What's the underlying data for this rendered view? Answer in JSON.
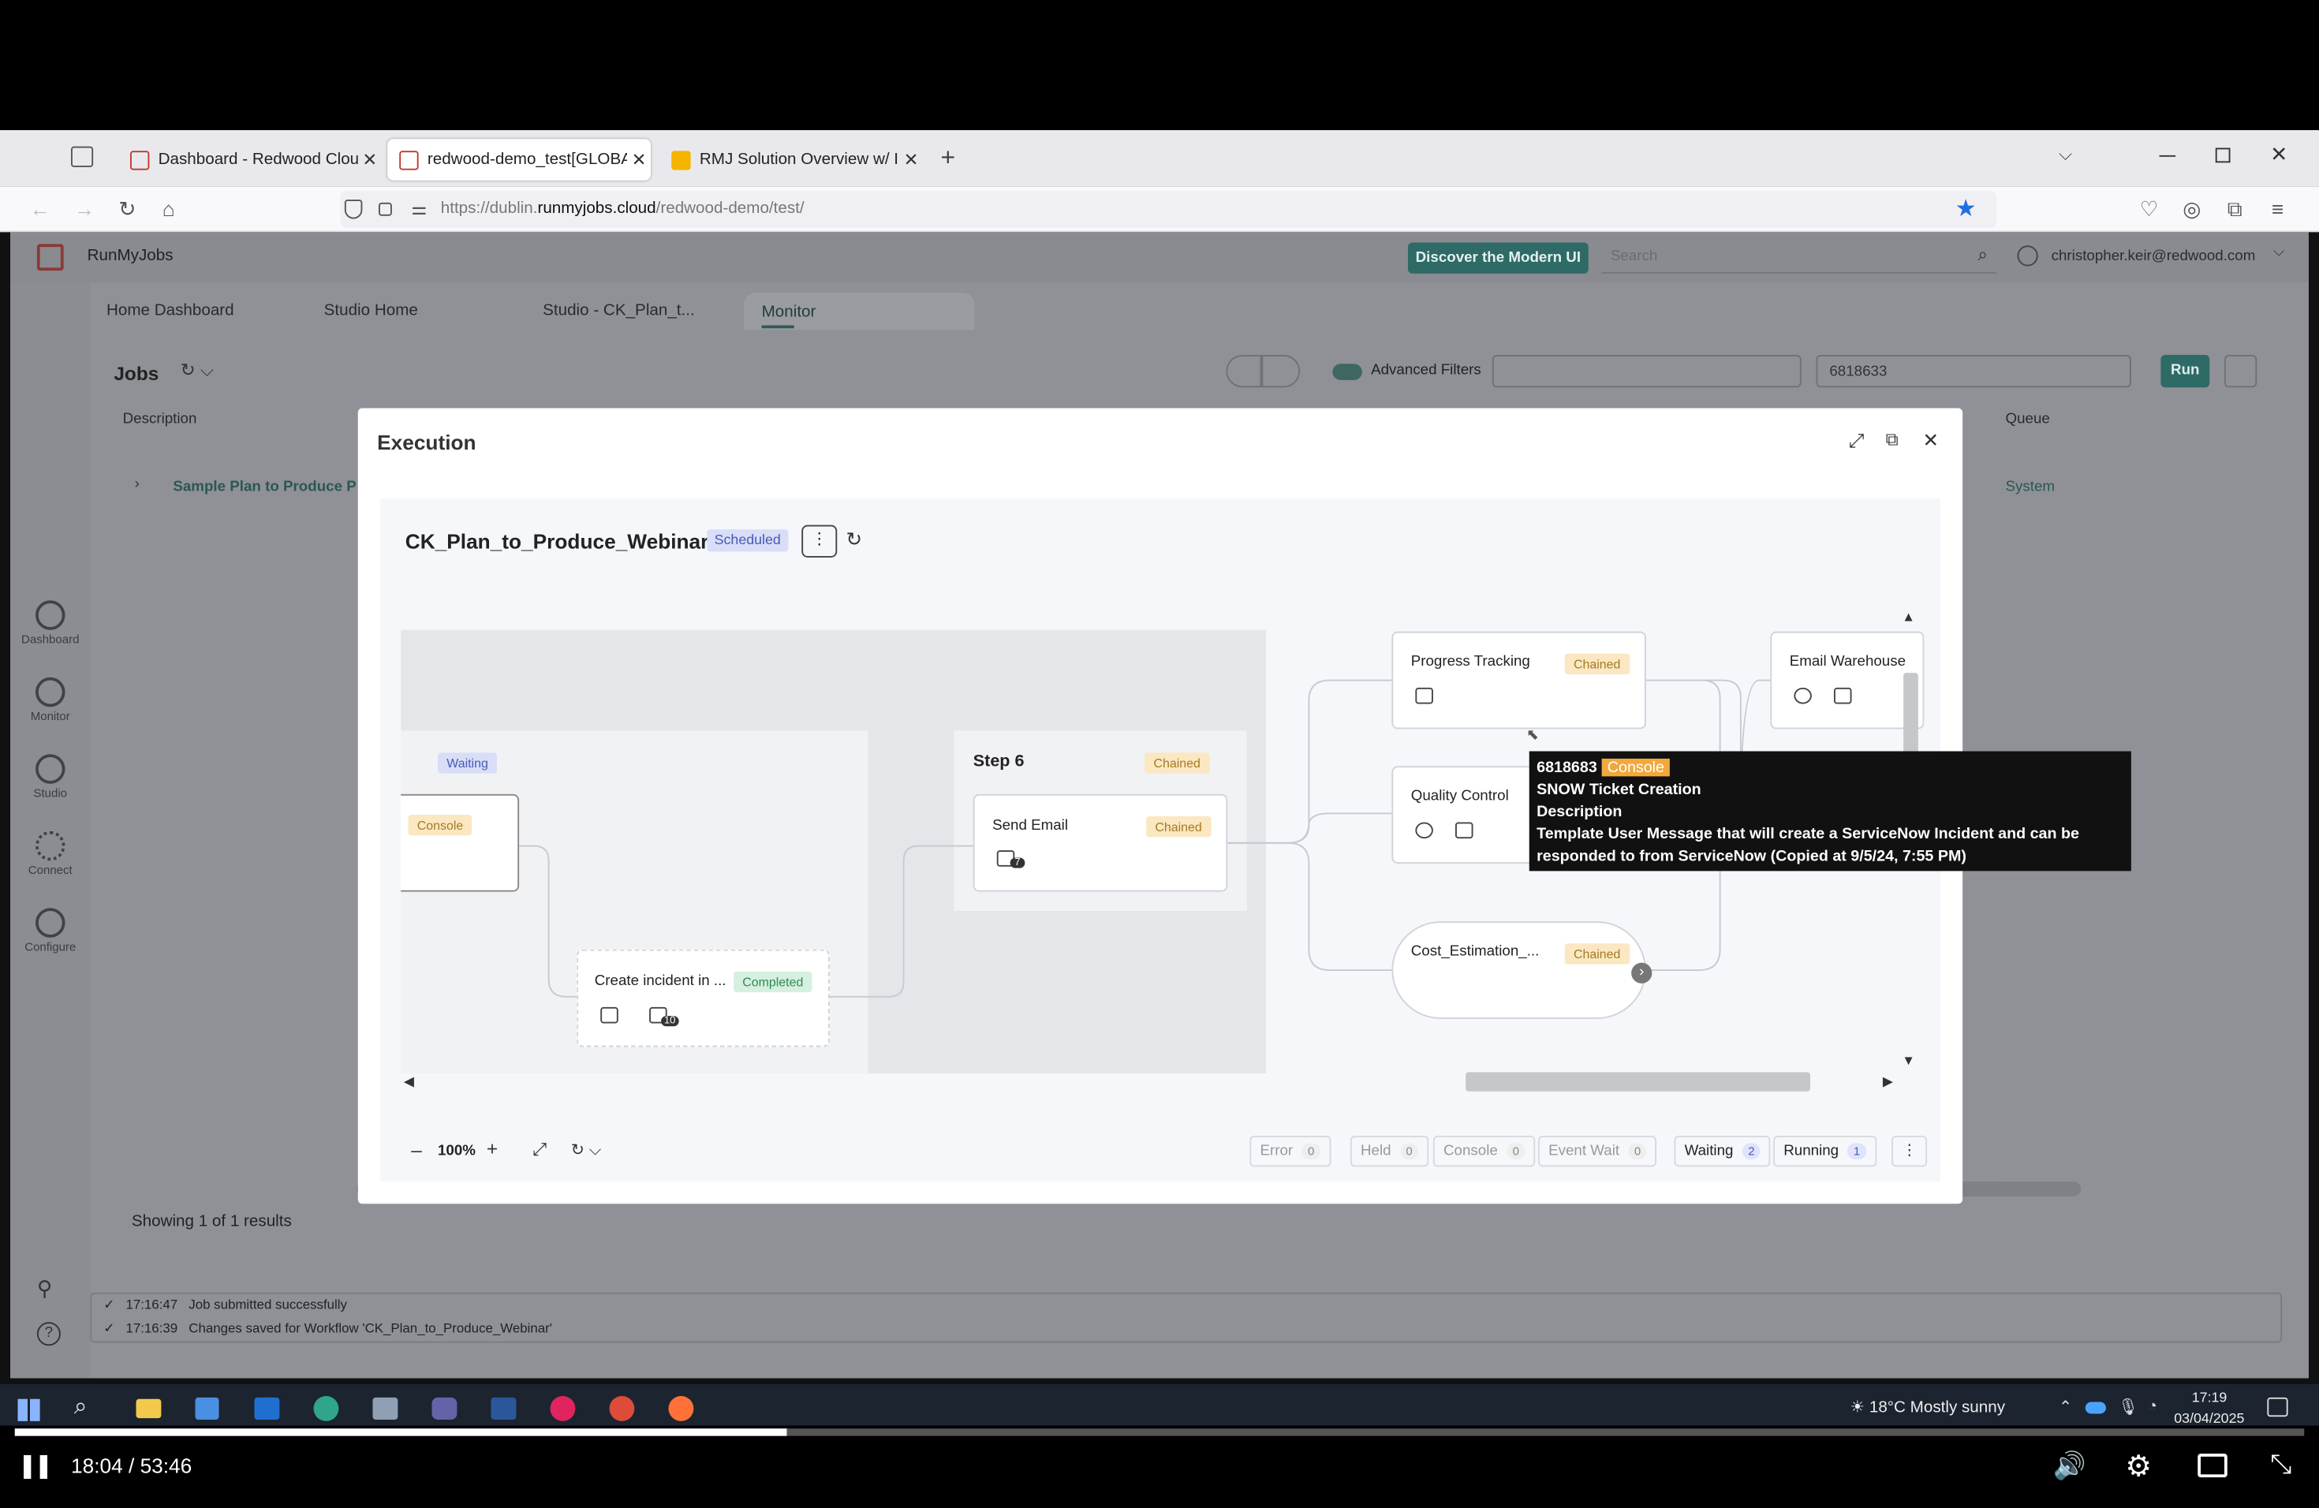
{
  "browser": {
    "tabs": [
      {
        "label": "Dashboard - Redwood Cloud",
        "active": false
      },
      {
        "label": "redwood-demo_test[GLOBAL]",
        "active": true
      },
      {
        "label": "RMJ Solution Overview w/ Insig",
        "active": false
      }
    ],
    "url_prefix": "https://dublin.",
    "url_domain": "runmyjobs.cloud",
    "url_path": "/redwood-demo/test/"
  },
  "app": {
    "name": "RunMyJobs",
    "discover_button": "Discover the Modern UI",
    "search_placeholder": "Search",
    "user": "christopher.keir@redwood.com",
    "tabs": [
      "Home Dashboard",
      "Studio Home",
      "Studio - CK_Plan_t...",
      "Monitor"
    ],
    "active_tab": "Monitor",
    "sidenav": [
      "Dashboard",
      "Monitor",
      "Studio",
      "Connect",
      "Configure"
    ],
    "jobs_title": "Jobs",
    "advanced_filters": "Advanced Filters",
    "filter_search": "6818633",
    "run_button": "Run",
    "col_description": "Description",
    "col_queue": "Queue",
    "row_description": "Sample Plan to Produce P",
    "row_queue": "System",
    "results": "Showing 1 of 1 results",
    "notifications": [
      {
        "time": "17:16:47",
        "text": "Job submitted successfully"
      },
      {
        "time": "17:16:39",
        "text": "Changes saved for Workflow 'CK_Plan_to_Produce_Webinar'"
      }
    ]
  },
  "modal": {
    "title": "Execution",
    "workflow_name": "CK_Plan_to_Produce_Webinar",
    "workflow_status": "Scheduled",
    "nodes": {
      "waiting_badge": "Waiting",
      "console_badge": "Console",
      "create_incident": {
        "label": "Create incident in ...",
        "badge": "Completed",
        "count": "10"
      },
      "step6": {
        "label": "Step 6",
        "badge": "Chained"
      },
      "send_email": {
        "label": "Send Email",
        "badge": "Chained",
        "count": "7"
      },
      "progress_tracking": {
        "label": "Progress Tracking",
        "badge": "Chained"
      },
      "quality_control": {
        "label": "Quality Control"
      },
      "cost_estimation": {
        "label": "Cost_Estimation_...",
        "badge": "Chained"
      },
      "email_warehouse": {
        "label": "Email Warehouse"
      }
    },
    "tooltip": {
      "job_id": "6818683",
      "badge": "Console",
      "name": "SNOW Ticket Creation",
      "desc_heading": "Description",
      "desc_line1": "Template User Message that will create a ServiceNow Incident and can be",
      "desc_line2": "responded to from ServiceNow (Copied at 9/5/24, 7:55 PM)"
    },
    "zoom": "100%",
    "status_pills": [
      {
        "label": "Error",
        "count": "0",
        "active": false
      },
      {
        "label": "Held",
        "count": "0",
        "active": false
      },
      {
        "label": "Console",
        "count": "0",
        "active": false
      },
      {
        "label": "Event Wait",
        "count": "0",
        "active": false
      },
      {
        "label": "Waiting",
        "count": "2",
        "active": true
      },
      {
        "label": "Running",
        "count": "1",
        "active": true
      }
    ]
  },
  "taskbar": {
    "weather": "18°C  Mostly sunny",
    "time": "17:19",
    "date": "03/04/2025"
  },
  "video": {
    "time": "18:04 / 53:46",
    "progress": 0.337
  },
  "colors": {
    "accent": "#2f7d78",
    "star": "#1f6fe5",
    "chained_badge": "#fbe7c1",
    "waiting_badge": "#d8def7",
    "completed_badge": "#d5f0df"
  }
}
